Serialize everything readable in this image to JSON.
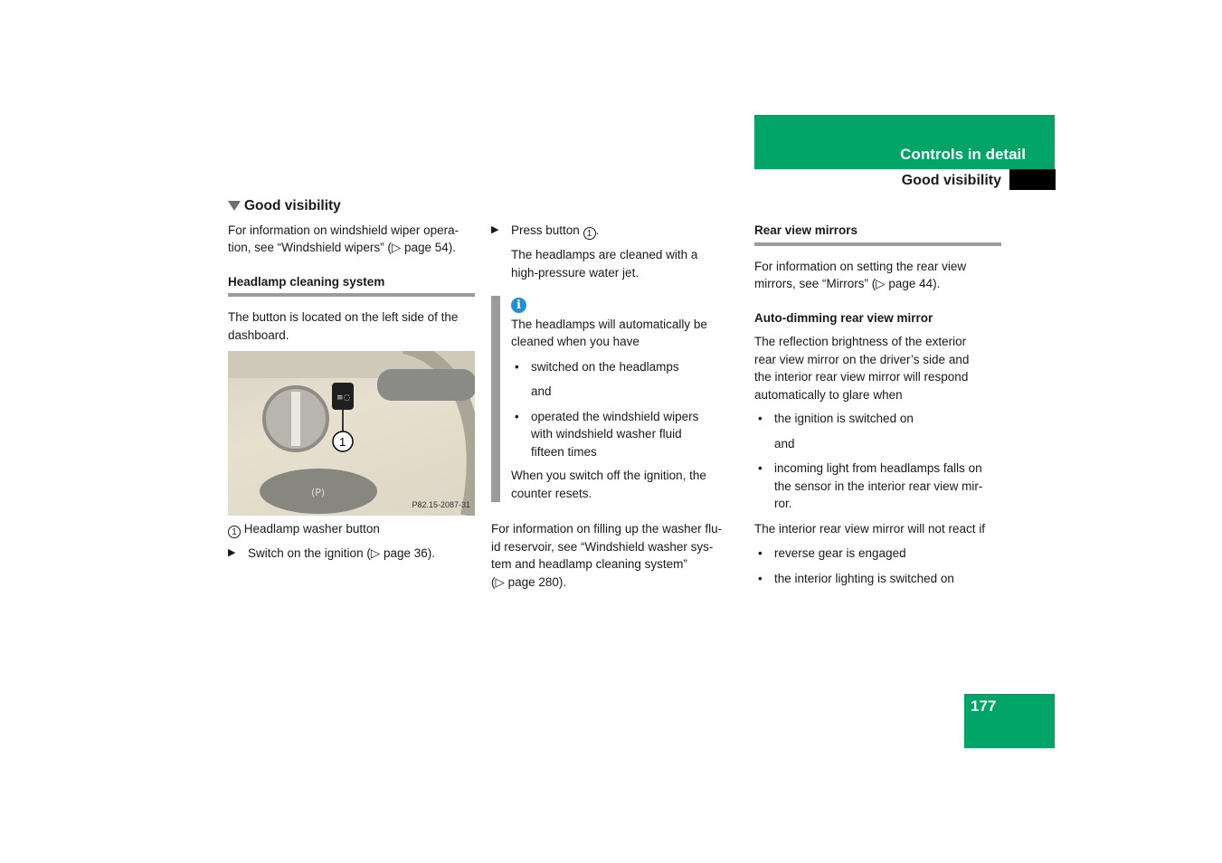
{
  "header": {
    "section": "Controls in detail",
    "subsection": "Good visibility"
  },
  "page_number": "177",
  "col1": {
    "heading": "Good visibility",
    "intro": [
      "For information on windshield wiper opera-",
      "tion, see “Windshield wipers” (▷ page 54)."
    ],
    "headlamp_heading": "Headlamp cleaning system",
    "location": [
      "The button is located on the left side of the",
      "dashboard."
    ],
    "figure_code": "P82.15-2087-31",
    "callout": "1",
    "legend": "Headlamp washer button",
    "step1": "Switch on the ignition (▷ page 36)."
  },
  "col2": {
    "step2": "Press button",
    "step2_ref": "1",
    "result": [
      "The headlamps are cleaned with a",
      "high-pressure water jet."
    ],
    "note_intro": [
      "The headlamps will automatically be",
      "cleaned when you have"
    ],
    "note_bullet1": "switched on the headlamps",
    "note_and": "and",
    "note_bullet2": [
      "operated the windshield wipers",
      "with windshield washer fluid",
      "fifteen times"
    ],
    "note_end": [
      "When you switch off the ignition, the",
      "counter resets."
    ],
    "washer": [
      "For information on filling up the washer flu-",
      "id reservoir, see “Windshield washer sys-",
      "tem and headlamp cleaning system”",
      "(▷ page 280)."
    ]
  },
  "col3": {
    "mirrors_heading": "Rear view mirrors",
    "mirrors_text": [
      "For information on setting the rear view",
      "mirrors, see “Mirrors” (▷ page 44)."
    ],
    "auto_heading": "Auto-dimming rear view mirror",
    "auto_text": [
      "The reflection brightness of the exterior",
      "rear view mirror on the driver’s side and",
      "the interior rear view mirror will respond",
      "automatically to glare when"
    ],
    "bullet1": "the ignition is switched on",
    "and": "and",
    "bullet2": [
      "incoming light from headlamps falls on",
      "the sensor in the interior rear view mir-",
      "ror."
    ],
    "not_react": "The interior rear view mirror will not react if",
    "bullet3": "reverse gear is engaged",
    "bullet4": "the interior lighting is switched on"
  }
}
